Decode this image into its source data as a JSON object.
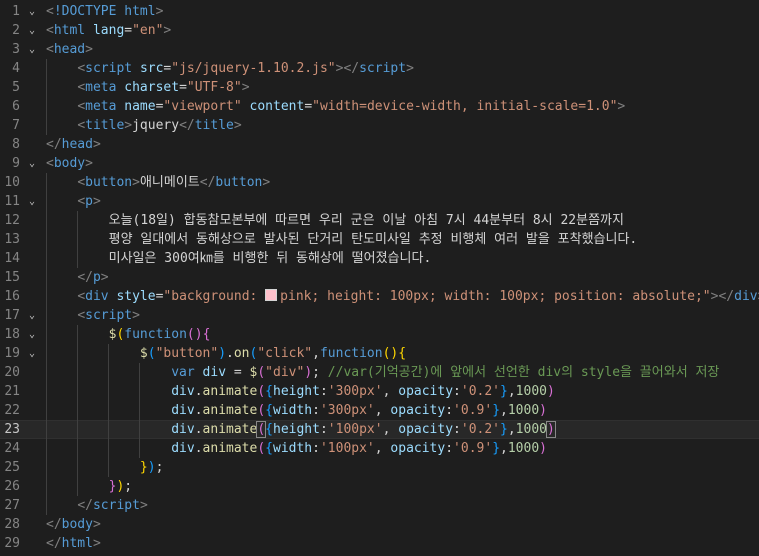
{
  "editor": {
    "language": "html",
    "active_line": 23,
    "lines": [
      {
        "n": "1",
        "fold": "v",
        "indent": 0,
        "tokens": [
          [
            "p",
            "<"
          ],
          [
            "tag",
            "!DOCTYPE"
          ],
          [
            "txt",
            " "
          ],
          [
            "tag",
            "html"
          ],
          [
            "p",
            ">"
          ]
        ]
      },
      {
        "n": "2",
        "fold": "v",
        "indent": 0,
        "tokens": [
          [
            "p",
            "<"
          ],
          [
            "tag",
            "html"
          ],
          [
            "txt",
            " "
          ],
          [
            "attr",
            "lang"
          ],
          [
            "txt",
            "="
          ],
          [
            "str",
            "\"en\""
          ],
          [
            "p",
            ">"
          ]
        ]
      },
      {
        "n": "3",
        "fold": "v",
        "indent": 0,
        "tokens": [
          [
            "p",
            "<"
          ],
          [
            "tag",
            "head"
          ],
          [
            "p",
            ">"
          ]
        ]
      },
      {
        "n": "4",
        "fold": "",
        "indent": 1,
        "tokens": [
          [
            "p",
            "<"
          ],
          [
            "tag",
            "script"
          ],
          [
            "txt",
            " "
          ],
          [
            "attr",
            "src"
          ],
          [
            "txt",
            "="
          ],
          [
            "str",
            "\"js/jquery-1.10.2.js\""
          ],
          [
            "p",
            "></"
          ],
          [
            "tag",
            "script"
          ],
          [
            "p",
            ">"
          ]
        ]
      },
      {
        "n": "5",
        "fold": "",
        "indent": 1,
        "tokens": [
          [
            "p",
            "<"
          ],
          [
            "tag",
            "meta"
          ],
          [
            "txt",
            " "
          ],
          [
            "attr",
            "charset"
          ],
          [
            "txt",
            "="
          ],
          [
            "str",
            "\"UTF-8\""
          ],
          [
            "p",
            ">"
          ]
        ]
      },
      {
        "n": "6",
        "fold": "",
        "indent": 1,
        "tokens": [
          [
            "p",
            "<"
          ],
          [
            "tag",
            "meta"
          ],
          [
            "txt",
            " "
          ],
          [
            "attr",
            "name"
          ],
          [
            "txt",
            "="
          ],
          [
            "str",
            "\"viewport\""
          ],
          [
            "txt",
            " "
          ],
          [
            "attr",
            "content"
          ],
          [
            "txt",
            "="
          ],
          [
            "str",
            "\"width=device-width, initial-scale=1.0\""
          ],
          [
            "p",
            ">"
          ]
        ]
      },
      {
        "n": "7",
        "fold": "",
        "indent": 1,
        "tokens": [
          [
            "p",
            "<"
          ],
          [
            "tag",
            "title"
          ],
          [
            "p",
            ">"
          ],
          [
            "txt",
            "jquery"
          ],
          [
            "p",
            "</"
          ],
          [
            "tag",
            "title"
          ],
          [
            "p",
            ">"
          ]
        ]
      },
      {
        "n": "8",
        "fold": "",
        "indent": 0,
        "tokens": [
          [
            "p",
            "</"
          ],
          [
            "tag",
            "head"
          ],
          [
            "p",
            ">"
          ]
        ]
      },
      {
        "n": "9",
        "fold": "v",
        "indent": 0,
        "tokens": [
          [
            "p",
            "<"
          ],
          [
            "tag",
            "body"
          ],
          [
            "p",
            ">"
          ]
        ]
      },
      {
        "n": "10",
        "fold": "",
        "indent": 1,
        "tokens": [
          [
            "p",
            "<"
          ],
          [
            "tag",
            "button"
          ],
          [
            "p",
            ">"
          ],
          [
            "txt",
            "애니메이트"
          ],
          [
            "p",
            "</"
          ],
          [
            "tag",
            "button"
          ],
          [
            "p",
            ">"
          ]
        ]
      },
      {
        "n": "11",
        "fold": "v",
        "indent": 1,
        "tokens": [
          [
            "p",
            "<"
          ],
          [
            "tag",
            "p"
          ],
          [
            "p",
            ">"
          ]
        ]
      },
      {
        "n": "12",
        "fold": "",
        "indent": 2,
        "tokens": [
          [
            "txt",
            "오늘(18일) 합동참모본부에 따르면 우리 군은 이날 아침 7시 44분부터 8시 22분쯤까지"
          ]
        ]
      },
      {
        "n": "13",
        "fold": "",
        "indent": 2,
        "tokens": [
          [
            "txt",
            "평양 일대에서 동해상으로 발사된 단거리 탄도미사일 추정 비행체 여러 발을 포착했습니다."
          ]
        ]
      },
      {
        "n": "14",
        "fold": "",
        "indent": 2,
        "tokens": [
          [
            "txt",
            "미사일은 300여㎞를 비행한 뒤 동해상에 떨어졌습니다."
          ]
        ]
      },
      {
        "n": "15",
        "fold": "",
        "indent": 1,
        "tokens": [
          [
            "p",
            "</"
          ],
          [
            "tag",
            "p"
          ],
          [
            "p",
            ">"
          ]
        ]
      },
      {
        "n": "16",
        "fold": "",
        "indent": 1,
        "tokens": [
          [
            "p",
            "<"
          ],
          [
            "tag",
            "div"
          ],
          [
            "txt",
            " "
          ],
          [
            "attr",
            "style"
          ],
          [
            "txt",
            "="
          ],
          [
            "str",
            "\"background: "
          ],
          [
            "swatch",
            ""
          ],
          [
            "str",
            "pink; height: 100px; width: 100px; position: absolute;\""
          ],
          [
            "p",
            "></"
          ],
          [
            "tag",
            "div"
          ],
          [
            "p",
            ">"
          ]
        ]
      },
      {
        "n": "17",
        "fold": "v",
        "indent": 1,
        "tokens": [
          [
            "p",
            "<"
          ],
          [
            "tag",
            "script"
          ],
          [
            "p",
            ">"
          ]
        ]
      },
      {
        "n": "18",
        "fold": "v",
        "indent": 2,
        "tokens": [
          [
            "fn",
            "$"
          ],
          [
            "b1",
            "("
          ],
          [
            "kw",
            "function"
          ],
          [
            "b2",
            "()"
          ],
          [
            "b2",
            "{"
          ]
        ]
      },
      {
        "n": "19",
        "fold": "v",
        "indent": 3,
        "tokens": [
          [
            "fn",
            "$"
          ],
          [
            "b3",
            "("
          ],
          [
            "str",
            "\"button\""
          ],
          [
            "b3",
            ")"
          ],
          [
            "txt",
            "."
          ],
          [
            "fn",
            "on"
          ],
          [
            "b3",
            "("
          ],
          [
            "str",
            "\"click\""
          ],
          [
            "txt",
            ","
          ],
          [
            "kw",
            "function"
          ],
          [
            "b1",
            "()"
          ],
          [
            "b1",
            "{"
          ]
        ]
      },
      {
        "n": "20",
        "fold": "",
        "indent": 4,
        "tokens": [
          [
            "kw",
            "var"
          ],
          [
            "txt",
            " "
          ],
          [
            "var",
            "div"
          ],
          [
            "txt",
            " = "
          ],
          [
            "fn",
            "$"
          ],
          [
            "b2",
            "("
          ],
          [
            "str",
            "\"div\""
          ],
          [
            "b2",
            ")"
          ],
          [
            "txt",
            "; "
          ],
          [
            "cmt",
            "//var(기억공간)에 앞에서 선언한 div의 style을 끌어와서 저장"
          ]
        ]
      },
      {
        "n": "21",
        "fold": "",
        "indent": 4,
        "tokens": [
          [
            "var",
            "div"
          ],
          [
            "txt",
            "."
          ],
          [
            "fn",
            "animate"
          ],
          [
            "b2",
            "("
          ],
          [
            "b3",
            "{"
          ],
          [
            "var",
            "height"
          ],
          [
            "txt",
            ":"
          ],
          [
            "str",
            "'300px'"
          ],
          [
            "txt",
            ", "
          ],
          [
            "var",
            "opacity"
          ],
          [
            "txt",
            ":"
          ],
          [
            "str",
            "'0.2'"
          ],
          [
            "b3",
            "}"
          ],
          [
            "txt",
            ","
          ],
          [
            "num",
            "1000"
          ],
          [
            "b2",
            ")"
          ]
        ]
      },
      {
        "n": "22",
        "fold": "",
        "indent": 4,
        "tokens": [
          [
            "var",
            "div"
          ],
          [
            "txt",
            "."
          ],
          [
            "fn",
            "animate"
          ],
          [
            "b2",
            "("
          ],
          [
            "b3",
            "{"
          ],
          [
            "var",
            "width"
          ],
          [
            "txt",
            ":"
          ],
          [
            "str",
            "'300px'"
          ],
          [
            "txt",
            ", "
          ],
          [
            "var",
            "opacity"
          ],
          [
            "txt",
            ":"
          ],
          [
            "str",
            "'0.9'"
          ],
          [
            "b3",
            "}"
          ],
          [
            "txt",
            ","
          ],
          [
            "num",
            "1000"
          ],
          [
            "b2",
            ")"
          ]
        ]
      },
      {
        "n": "23",
        "fold": "",
        "indent": 4,
        "tokens": [
          [
            "var",
            "div"
          ],
          [
            "txt",
            "."
          ],
          [
            "fn",
            "animate"
          ],
          [
            "b2hl",
            "("
          ],
          [
            "b3",
            "{"
          ],
          [
            "var",
            "height"
          ],
          [
            "txt",
            ":"
          ],
          [
            "str",
            "'100px'"
          ],
          [
            "txt",
            ", "
          ],
          [
            "var",
            "opacity"
          ],
          [
            "txt",
            ":"
          ],
          [
            "str",
            "'0.2'"
          ],
          [
            "b3",
            "}"
          ],
          [
            "txt",
            ","
          ],
          [
            "num",
            "1000"
          ],
          [
            "b2hl",
            ")"
          ]
        ]
      },
      {
        "n": "24",
        "fold": "",
        "indent": 4,
        "tokens": [
          [
            "var",
            "div"
          ],
          [
            "txt",
            "."
          ],
          [
            "fn",
            "animate"
          ],
          [
            "b2",
            "("
          ],
          [
            "b3",
            "{"
          ],
          [
            "var",
            "width"
          ],
          [
            "txt",
            ":"
          ],
          [
            "str",
            "'100px'"
          ],
          [
            "txt",
            ", "
          ],
          [
            "var",
            "opacity"
          ],
          [
            "txt",
            ":"
          ],
          [
            "str",
            "'0.9'"
          ],
          [
            "b3",
            "}"
          ],
          [
            "txt",
            ","
          ],
          [
            "num",
            "1000"
          ],
          [
            "b2",
            ")"
          ]
        ]
      },
      {
        "n": "25",
        "fold": "",
        "indent": 3,
        "tokens": [
          [
            "b1",
            "}"
          ],
          [
            "b3",
            ")"
          ],
          [
            "txt",
            ";"
          ]
        ]
      },
      {
        "n": "26",
        "fold": "",
        "indent": 2,
        "tokens": [
          [
            "b2",
            "}"
          ],
          [
            "b1",
            ")"
          ],
          [
            "txt",
            ";"
          ]
        ]
      },
      {
        "n": "27",
        "fold": "",
        "indent": 1,
        "tokens": [
          [
            "p",
            "</"
          ],
          [
            "tag",
            "script"
          ],
          [
            "p",
            ">"
          ]
        ]
      },
      {
        "n": "28",
        "fold": "",
        "indent": 0,
        "tokens": [
          [
            "p",
            "</"
          ],
          [
            "tag",
            "body"
          ],
          [
            "p",
            ">"
          ]
        ]
      },
      {
        "n": "29",
        "fold": "",
        "indent": 0,
        "tokens": [
          [
            "p",
            "</"
          ],
          [
            "tag",
            "html"
          ],
          [
            "p",
            ">"
          ]
        ]
      }
    ]
  }
}
